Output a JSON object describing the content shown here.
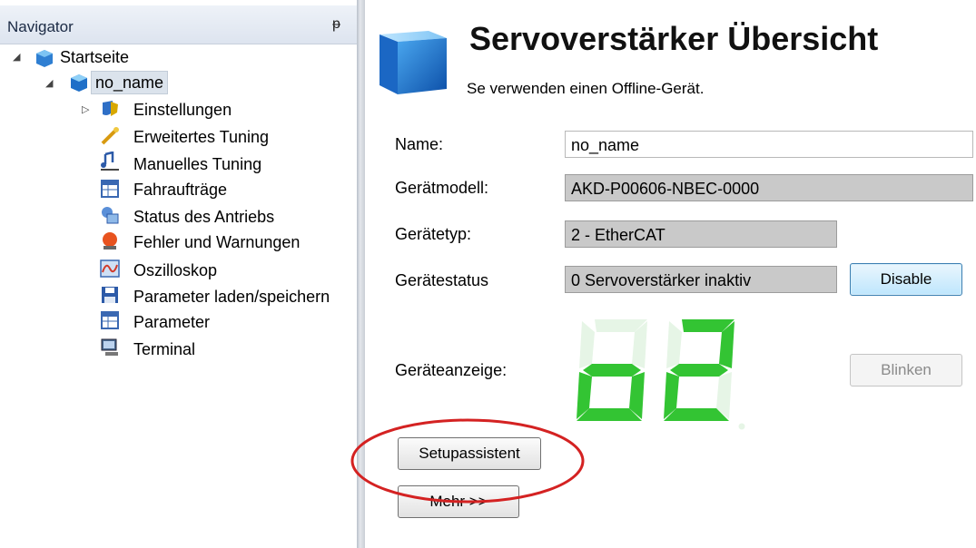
{
  "navigator": {
    "title": "Navigator",
    "pin_glyph": "ᵽ",
    "tree": [
      {
        "label": "Startseite",
        "icon": "home-cube-icon",
        "expanded": true
      },
      {
        "label": "no_name",
        "icon": "drive-cube-icon",
        "expanded": true,
        "selected": true
      },
      {
        "label": "Einstellungen",
        "icon": "settings-shield-icon",
        "expanded": false
      },
      {
        "label": "Erweitertes Tuning",
        "icon": "tuning-wand-icon"
      },
      {
        "label": "Manuelles Tuning",
        "icon": "manual-tuning-icon"
      },
      {
        "label": "Fahraufträge",
        "icon": "motion-tasks-icon"
      },
      {
        "label": "Status des Antriebs",
        "icon": "drive-status-icon"
      },
      {
        "label": "Fehler und Warnungen",
        "icon": "fault-warning-icon"
      },
      {
        "label": "Oszilloskop",
        "icon": "oscilloscope-icon"
      },
      {
        "label": "Parameter laden/speichern",
        "icon": "save-disk-icon"
      },
      {
        "label": "Parameter",
        "icon": "parameter-table-icon"
      },
      {
        "label": "Terminal",
        "icon": "terminal-icon"
      }
    ]
  },
  "overview": {
    "title": "Servoverstärker Übersicht",
    "subtitle": "Se verwenden einen Offline-Gerät.",
    "fields": {
      "name": {
        "label": "Name:",
        "value": "no_name"
      },
      "model": {
        "label": "Gerätmodell:",
        "value": "AKD-P00606-NBEC-0000"
      },
      "type": {
        "label": "Gerätetyp:",
        "value": "2 - EtherCAT"
      },
      "status": {
        "label": "Gerätestatus",
        "value": "0 Servoverstärker inaktiv"
      }
    },
    "display": {
      "label": "Geräteanzeige:",
      "digits": [
        "o",
        "2"
      ],
      "lit_color": "#33c433",
      "dim_color": "#e6f5e6"
    },
    "buttons": {
      "disable": "Disable",
      "blink": "Blinken",
      "setup": "Setupassistent",
      "more": "Mehr >>"
    },
    "annotation_color": "#d42222"
  }
}
